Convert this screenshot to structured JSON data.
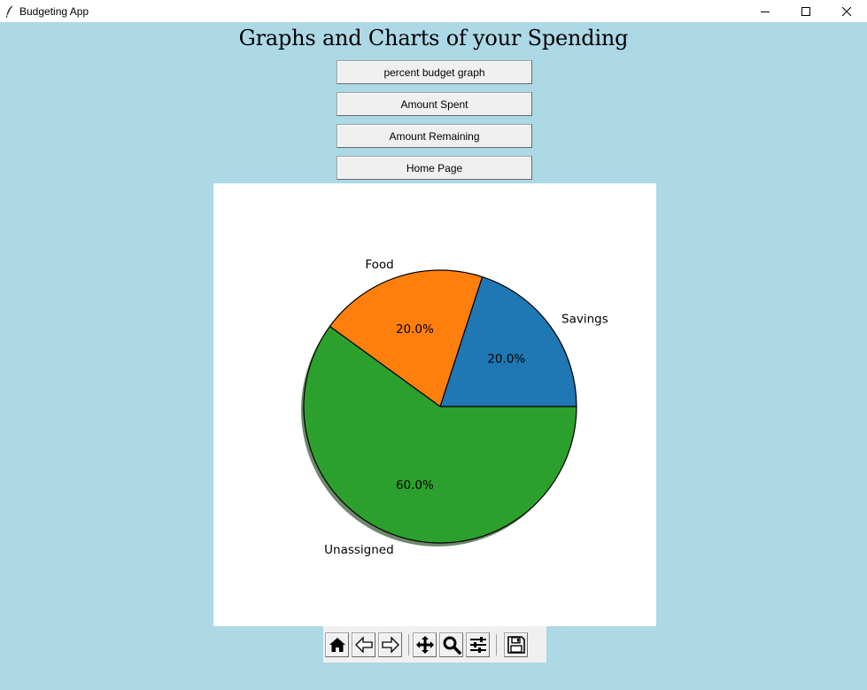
{
  "window": {
    "title": "Budgeting App"
  },
  "page": {
    "heading": "Graphs and Charts of your Spending"
  },
  "buttons": {
    "percent_budget": "percent budget graph",
    "amount_spent": "Amount Spent",
    "amount_remaining": "Amount Remaining",
    "home_page": "Home Page"
  },
  "chart_data": {
    "type": "pie",
    "categories": [
      "Savings",
      "Food",
      "Unassigned"
    ],
    "values": [
      20.0,
      20.0,
      60.0
    ],
    "labels": [
      "20.0%",
      "20.0%",
      "60.0%"
    ],
    "colors": [
      "#1f77b4",
      "#ff7f0e",
      "#2ca02c"
    ],
    "shadow": true,
    "start_angle_deg": 0
  },
  "toolbar_icons": [
    "home-icon",
    "back-arrow-icon",
    "forward-arrow-icon",
    "pan-icon",
    "zoom-icon",
    "configure-subplots-icon",
    "save-icon"
  ]
}
